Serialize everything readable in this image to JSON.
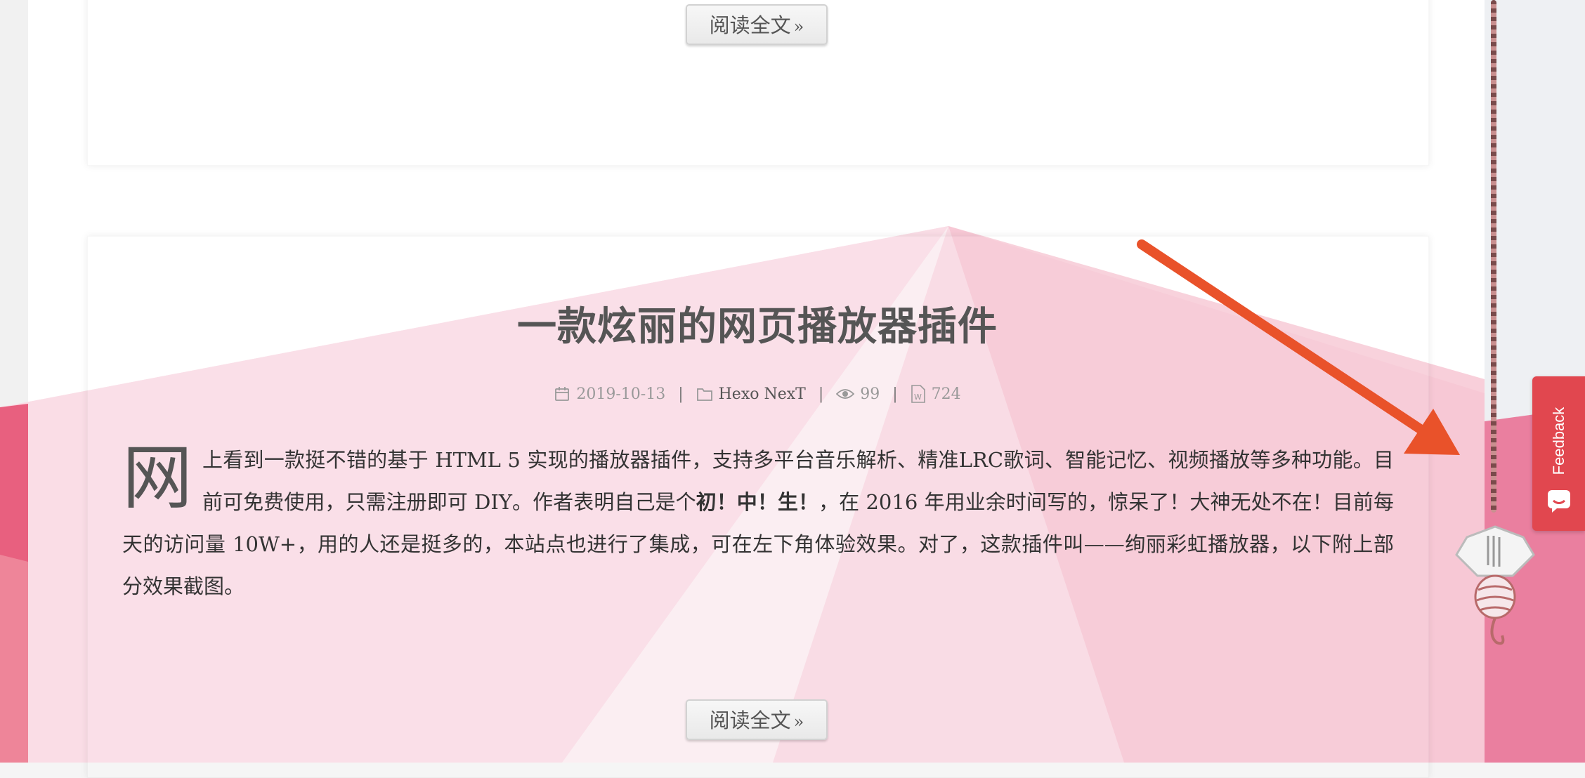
{
  "page": {
    "read_more_label": "阅读全文",
    "read_more_chevron": "»"
  },
  "post": {
    "title": "一款炫丽的网页播放器插件",
    "meta": {
      "date": "2019-10-13",
      "category": "Hexo NexT",
      "views": "99",
      "words": "724",
      "separator": "|"
    },
    "excerpt": {
      "dropcap": "网",
      "text_1": "上看到一款挺不错的基于 HTML 5 实现的播放器插件，支持多平台音乐解析、精准LRC歌词、智能记忆、视频播放等多种功能。目前可免费使用，只需注册即可 DIY。作者表明自己是个",
      "bold": "初！中！生！",
      "text_2": "，在 2016 年用业余时间写的，惊呆了！大神无处不在！目前每天的访问量 10W+，用的人还是挺多的，本站点也进行了集成，可在左下角体验效果。对了，这款插件叫——绚丽彩虹播放器，以下附上部分效果截图。"
    }
  },
  "feedback": {
    "label": "Feedback"
  },
  "icons": [
    "calendar-icon",
    "folder-icon",
    "eye-icon",
    "word-count-icon",
    "feedback-chat-icon"
  ],
  "colors": {
    "feedback_bg": "#e1474f",
    "arrow": "#e9522a",
    "ribbon_pink": "#f4c9d5",
    "ribbon_red": "#e8607f"
  }
}
